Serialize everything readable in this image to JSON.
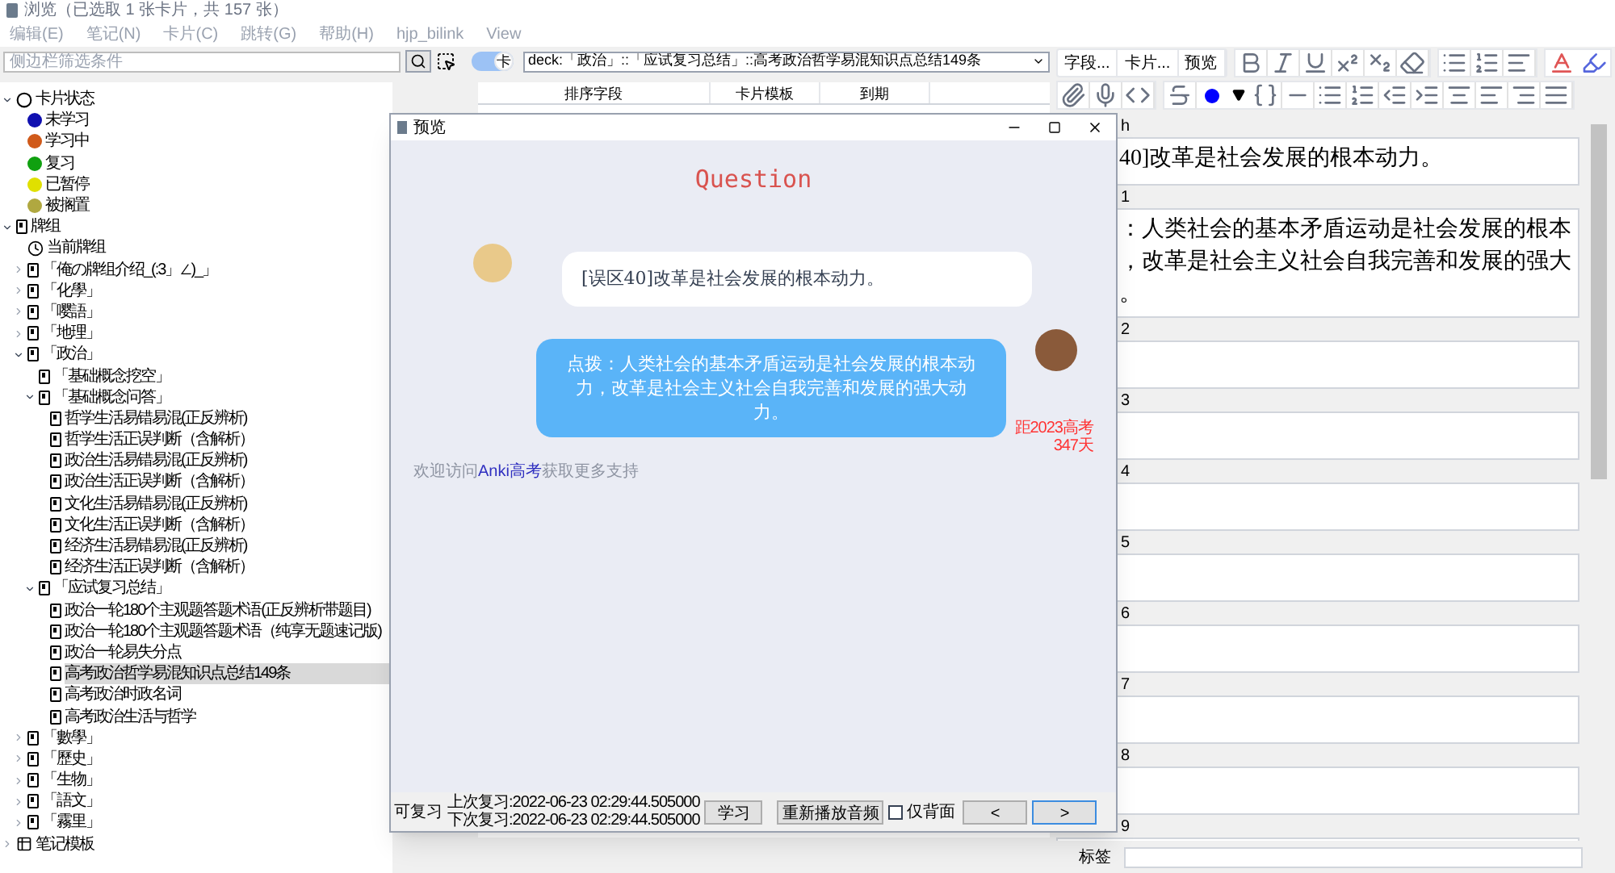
{
  "window": {
    "title": "浏览（已选取 1 张卡片，共 157 张）"
  },
  "menu": [
    "编辑(E)",
    "笔记(N)",
    "卡片(C)",
    "跳转(G)",
    "帮助(H)",
    "hjp_bilink",
    "View"
  ],
  "sidebar": {
    "filter_placeholder": "侧边栏筛选条件",
    "tree": [
      {
        "label": "卡片状态",
        "kind": "search",
        "expanded": true,
        "selected": false,
        "children": [
          {
            "label": "未学习",
            "kind": "state",
            "color": "#1010b0",
            "selected": false
          },
          {
            "label": "学习中",
            "kind": "state",
            "color": "#d05a1a",
            "selected": false
          },
          {
            "label": "复习",
            "kind": "state",
            "color": "#10a010",
            "selected": false
          },
          {
            "label": "已暂停",
            "kind": "state",
            "color": "#e0e000",
            "selected": false
          },
          {
            "label": "被搁置",
            "kind": "state",
            "color": "#b0a840",
            "selected": false
          }
        ]
      },
      {
        "label": "牌组",
        "kind": "deck",
        "expanded": true,
        "selected": false,
        "children": [
          {
            "label": "当前牌组",
            "kind": "current",
            "selected": false
          },
          {
            "label": "「俺の牌组介绍_(:3」∠)_」",
            "kind": "deck",
            "expanded": false,
            "selected": false
          },
          {
            "label": "「化學」",
            "kind": "deck",
            "expanded": false,
            "selected": false
          },
          {
            "label": "「嘤語」",
            "kind": "deck",
            "expanded": false,
            "selected": false
          },
          {
            "label": "「地理」",
            "kind": "deck",
            "expanded": false,
            "selected": false
          },
          {
            "label": "「政治」",
            "kind": "deck",
            "expanded": true,
            "selected": false,
            "children": [
              {
                "label": "「基础概念挖空」",
                "kind": "deck",
                "selected": false
              },
              {
                "label": "「基础概念问答」",
                "kind": "deck",
                "expanded": true,
                "selected": false,
                "children": [
                  {
                    "label": "哲学生活易错易混(正反辨析)",
                    "kind": "deck",
                    "selected": false
                  },
                  {
                    "label": "哲学生活正误判断（含解析）",
                    "kind": "deck",
                    "selected": false
                  },
                  {
                    "label": "政治生活易错易混(正反辨析)",
                    "kind": "deck",
                    "selected": false
                  },
                  {
                    "label": "政治生活正误判断（含解析）",
                    "kind": "deck",
                    "selected": false
                  },
                  {
                    "label": "文化生活易错易混(正反辨析)",
                    "kind": "deck",
                    "selected": false
                  },
                  {
                    "label": "文化生活正误判断（含解析）",
                    "kind": "deck",
                    "selected": false
                  },
                  {
                    "label": "经济生活易错易混(正反辨析)",
                    "kind": "deck",
                    "selected": false
                  },
                  {
                    "label": "经济生活正误判断（含解析）",
                    "kind": "deck",
                    "selected": false
                  }
                ]
              },
              {
                "label": "「应试复习总结」",
                "kind": "deck",
                "expanded": true,
                "selected": false,
                "children": [
                  {
                    "label": "政治一轮180个主观题答题术语(正反辨析带题目)",
                    "kind": "deck",
                    "selected": false
                  },
                  {
                    "label": "政治一轮180个主观题答题术语（纯享无题速记版)",
                    "kind": "deck",
                    "selected": false
                  },
                  {
                    "label": "政治一轮易失分点",
                    "kind": "deck",
                    "selected": false
                  },
                  {
                    "label": "高考政治哲学易混知识点总结149条",
                    "kind": "deck",
                    "selected": true
                  },
                  {
                    "label": "高考政治时政名词",
                    "kind": "deck",
                    "selected": false
                  },
                  {
                    "label": "高考政治生活与哲学",
                    "kind": "deck",
                    "selected": false
                  }
                ]
              }
            ]
          },
          {
            "label": "「數學」",
            "kind": "deck",
            "expanded": false,
            "selected": false
          },
          {
            "label": "「歷史」",
            "kind": "deck",
            "expanded": false,
            "selected": false
          },
          {
            "label": "「生物」",
            "kind": "deck",
            "expanded": false,
            "selected": false
          },
          {
            "label": "「語文」",
            "kind": "deck",
            "expanded": false,
            "selected": false
          },
          {
            "label": "「霧里」",
            "kind": "deck",
            "expanded": false,
            "selected": false
          }
        ]
      },
      {
        "label": "笔记模板",
        "kind": "template",
        "expanded": false,
        "selected": false
      }
    ]
  },
  "browser": {
    "mode_toggle": {
      "label": "卡",
      "on": true
    },
    "search": "deck:「政治」::「应试复习总结」::高考政治哲学易混知识点总结149条",
    "columns": [
      "排序字段",
      "卡片模板",
      "到期"
    ]
  },
  "editor": {
    "buttons": [
      "字段...",
      "卡片...",
      "预览"
    ],
    "fields": [
      {
        "label": "h",
        "lines": [
          "40]改革是社会发展的根本动力。"
        ]
      },
      {
        "label": "1",
        "lines": [
          "：人类社会的基本矛盾运动是社会发展的根本",
          "，改革是社会主义社会自我完善和发展的强大",
          "。"
        ]
      },
      {
        "label": "2"
      },
      {
        "label": "3"
      },
      {
        "label": "4"
      },
      {
        "label": "5"
      },
      {
        "label": "6"
      },
      {
        "label": "7"
      },
      {
        "label": "8"
      },
      {
        "label": "9"
      }
    ],
    "tags_label": "标签"
  },
  "preview": {
    "title": "预览",
    "heading": "Question",
    "question": "[误区40]改革是社会发展的根本动力。",
    "answer": "点拨：人类社会的基本矛盾运动是社会发展的根本动力，改革是社会主义社会自我完善和发展的强大动力。",
    "countdown": [
      "距2023高考",
      "347天"
    ],
    "footer": {
      "before": "欢迎访问",
      "link": "Anki高考",
      "after": "获取更多支持"
    },
    "status": "可复习",
    "last_review": "上次复习:2022-06-23 02:29:44.505000",
    "next_review": "下次复习:2022-06-23 02:29:44.505000",
    "buttons": [
      "学习",
      "重新播放音频"
    ],
    "back_only": {
      "label": "仅背面",
      "checked": false
    },
    "nav": [
      "<",
      ">"
    ]
  }
}
